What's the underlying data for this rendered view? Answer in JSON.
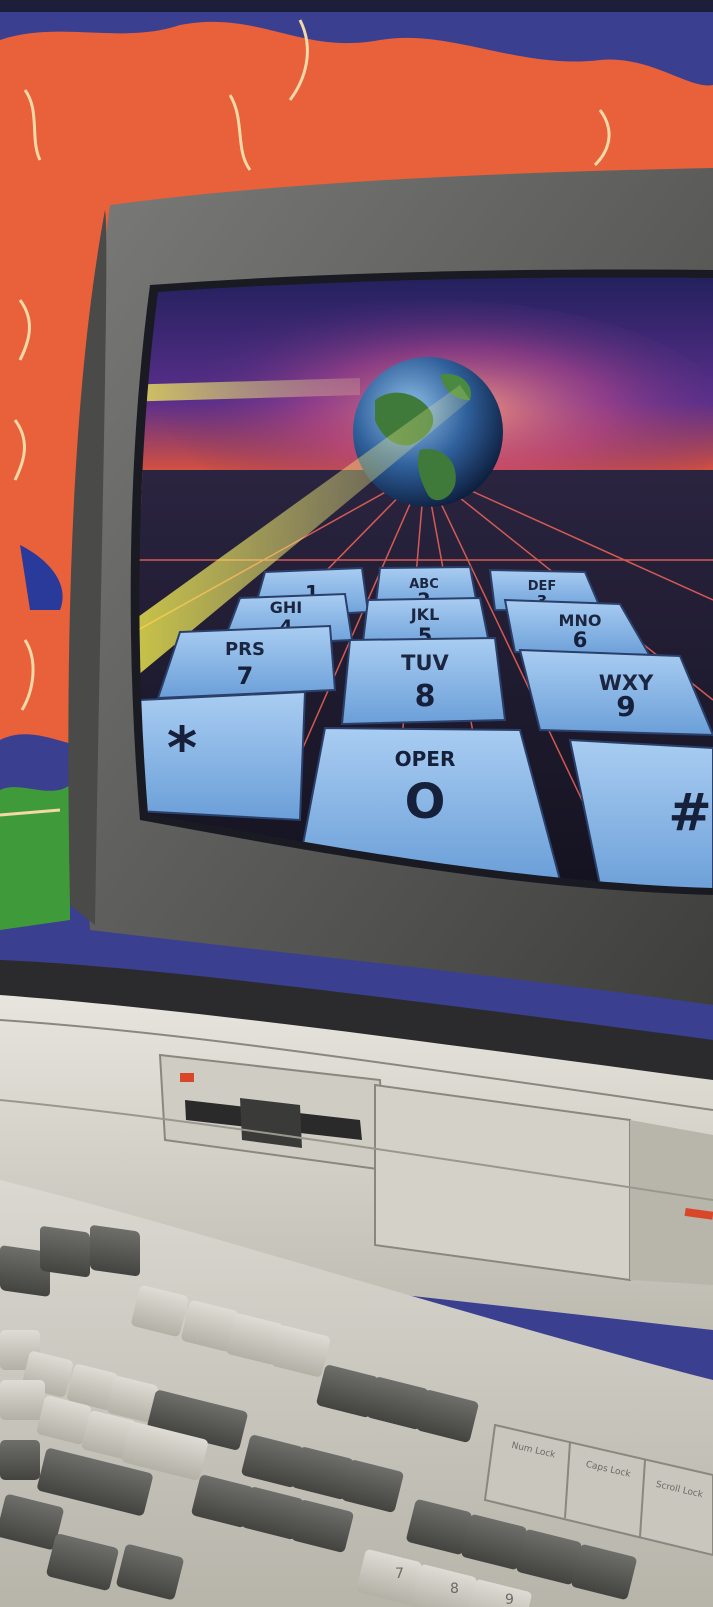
{
  "phone_keypad": {
    "keys": [
      {
        "letters": "",
        "digit": "1"
      },
      {
        "letters": "ABC",
        "digit": "2"
      },
      {
        "letters": "DEF",
        "digit": "3"
      },
      {
        "letters": "GHI",
        "digit": "4"
      },
      {
        "letters": "JKL",
        "digit": "5"
      },
      {
        "letters": "MNO",
        "digit": "6"
      },
      {
        "letters": "PRS",
        "digit": "7"
      },
      {
        "letters": "TUV",
        "digit": "8"
      },
      {
        "letters": "WXY",
        "digit": "9"
      },
      {
        "letters": "",
        "digit": "*"
      },
      {
        "letters": "OPER",
        "digit": "O"
      },
      {
        "letters": "",
        "digit": "#"
      }
    ]
  },
  "keyboard": {
    "lock_keys": [
      "Num Lock",
      "Caps Lock",
      "Scroll Lock"
    ],
    "numpad_digits": [
      "7",
      "8",
      "9"
    ]
  },
  "colors": {
    "background_orange": "#e8613a",
    "background_blue": "#3b3f8f",
    "monitor_gray": "#6b6b6b",
    "screen_purple": "#3a2a78",
    "key_blue": "#7fb3ea",
    "beam_yellow": "#f4ee3a",
    "keyboard_beige": "#d9d7cf"
  }
}
